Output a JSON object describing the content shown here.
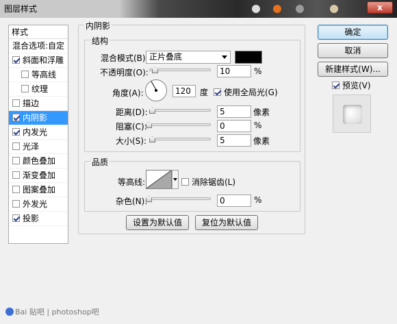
{
  "window": {
    "title": "图层样式",
    "close_glyph": "x"
  },
  "style_list": {
    "header": "样式",
    "blend_options": "混合选项:自定",
    "items": [
      {
        "label": "斜面和浮雕",
        "checked": true,
        "sub": false,
        "selected": false
      },
      {
        "label": "等高线",
        "checked": false,
        "sub": true,
        "selected": false
      },
      {
        "label": "纹理",
        "checked": false,
        "sub": true,
        "selected": false
      },
      {
        "label": "描边",
        "checked": false,
        "sub": false,
        "selected": false
      },
      {
        "label": "内阴影",
        "checked": true,
        "sub": false,
        "selected": true
      },
      {
        "label": "内发光",
        "checked": true,
        "sub": false,
        "selected": false
      },
      {
        "label": "光泽",
        "checked": false,
        "sub": false,
        "selected": false
      },
      {
        "label": "颜色叠加",
        "checked": false,
        "sub": false,
        "selected": false
      },
      {
        "label": "渐变叠加",
        "checked": false,
        "sub": false,
        "selected": false
      },
      {
        "label": "图案叠加",
        "checked": false,
        "sub": false,
        "selected": false
      },
      {
        "label": "外发光",
        "checked": false,
        "sub": false,
        "selected": false
      },
      {
        "label": "投影",
        "checked": true,
        "sub": false,
        "selected": false
      }
    ]
  },
  "inner_shadow": {
    "title": "内阴影",
    "structure": {
      "title": "结构",
      "blend_mode_label": "混合模式(B):",
      "blend_mode_value": "正片叠底",
      "blend_color": "#000000",
      "opacity_label": "不透明度(O):",
      "opacity_value": "10",
      "opacity_unit": "%",
      "opacity_level": 0.1,
      "angle_label": "角度(A):",
      "angle_value": "120",
      "angle_unit": "度",
      "global_light_label": "使用全局光(G)",
      "global_light_checked": true,
      "distance_label": "距离(D):",
      "distance_value": "5",
      "distance_unit": "像素",
      "choke_label": "阻塞(C):",
      "choke_value": "0",
      "choke_unit": "%",
      "size_label": "大小(S):",
      "size_value": "5",
      "size_unit": "像素"
    },
    "quality": {
      "title": "品质",
      "contour_label": "等高线:",
      "anti_alias_label": "消除锯齿(L)",
      "anti_alias_checked": false,
      "noise_label": "杂色(N):",
      "noise_value": "0",
      "noise_unit": "%"
    },
    "make_default": "设置为默认值",
    "reset_default": "复位为默认值"
  },
  "buttons": {
    "ok": "确定",
    "cancel": "取消",
    "new_style": "新建样式(W)...",
    "preview_label": "预览(V)",
    "preview_checked": true
  },
  "watermark": "Bai 贴吧 | photoshop吧"
}
